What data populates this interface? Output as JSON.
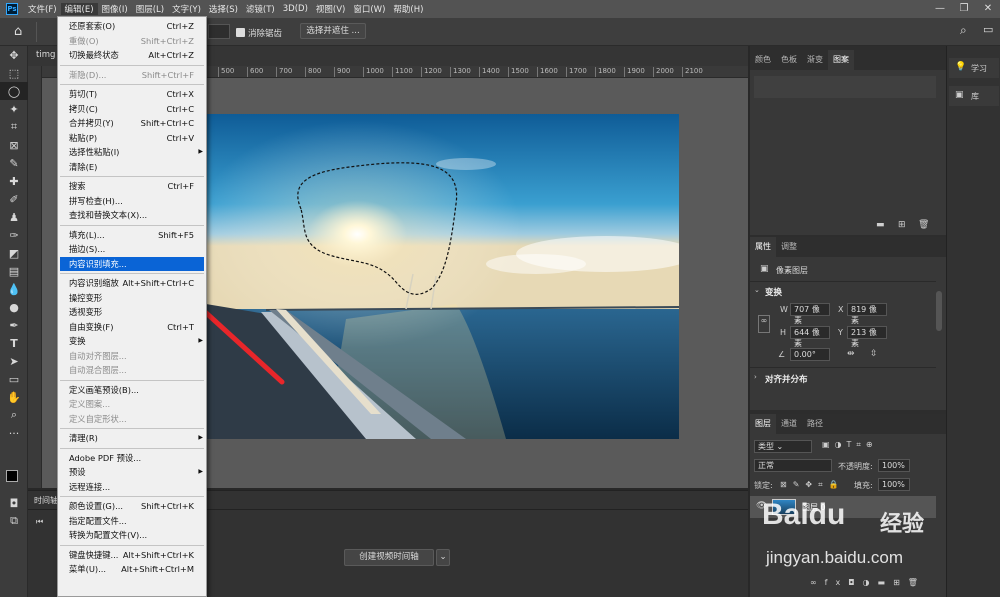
{
  "menubar": {
    "logo": "Ps",
    "items": [
      "文件(F)",
      "编辑(E)",
      "图像(I)",
      "图层(L)",
      "文字(Y)",
      "选择(S)",
      "滤镜(T)",
      "3D(D)",
      "视图(V)",
      "窗口(W)",
      "帮助(H)"
    ],
    "active_index": 1
  },
  "optionsbar": {
    "antialias_label": "消除锯齿",
    "select_mask_label": "选择并遮住 ..."
  },
  "document": {
    "tab_label": "timg",
    "ruler_ticks": [
      "500",
      "600",
      "700",
      "800",
      "900",
      "1000",
      "1100",
      "1200",
      "1300",
      "1400",
      "1500",
      "1600",
      "1700",
      "1800",
      "1900",
      "2000",
      "2100"
    ]
  },
  "timeline": {
    "tab_label": "时间轴",
    "create_button": "创建视频时间轴"
  },
  "color_panel": {
    "tabs": [
      "颜色",
      "色板",
      "渐变",
      "图案"
    ],
    "active": 3
  },
  "properties_panel": {
    "tabs": [
      "属性",
      "调整"
    ],
    "layer_type": "像素图层",
    "transform_title": "变换",
    "w_label": "W",
    "w_value": "707 像素",
    "h_label": "H",
    "h_value": "644 像素",
    "x_label": "X",
    "x_value": "819 像素",
    "y_label": "Y",
    "y_value": "213 像素",
    "angle_value": "0.00°",
    "align_title": "对齐并分布"
  },
  "layers_panel": {
    "tabs": [
      "图层",
      "通道",
      "路径"
    ],
    "filter_kind": "类型",
    "blend_mode": "正常",
    "opacity_label": "不透明度:",
    "opacity_value": "100%",
    "lock_label": "锁定:",
    "fill_label": "填充:",
    "fill_value": "100%",
    "layer_name": "图层 0"
  },
  "far_right": {
    "learn_label": "学习",
    "library_label": "库"
  },
  "edit_menu": {
    "items": [
      {
        "label": "还原套索(O)",
        "shortcut": "Ctrl+Z",
        "disabled": false
      },
      {
        "label": "重做(O)",
        "shortcut": "Shift+Ctrl+Z",
        "disabled": true
      },
      {
        "label": "切换最终状态",
        "shortcut": "Alt+Ctrl+Z",
        "disabled": false
      },
      {
        "sep": true
      },
      {
        "label": "渐隐(D)...",
        "shortcut": "Shift+Ctrl+F",
        "disabled": true
      },
      {
        "sep": true
      },
      {
        "label": "剪切(T)",
        "shortcut": "Ctrl+X",
        "disabled": false
      },
      {
        "label": "拷贝(C)",
        "shortcut": "Ctrl+C",
        "disabled": false
      },
      {
        "label": "合并拷贝(Y)",
        "shortcut": "Shift+Ctrl+C",
        "disabled": false
      },
      {
        "label": "粘贴(P)",
        "shortcut": "Ctrl+V",
        "disabled": false
      },
      {
        "label": "选择性粘贴(I)",
        "shortcut": "",
        "disabled": false,
        "submenu": true
      },
      {
        "label": "清除(E)",
        "shortcut": "",
        "disabled": false
      },
      {
        "sep": true
      },
      {
        "label": "搜索",
        "shortcut": "Ctrl+F",
        "disabled": false
      },
      {
        "label": "拼写检查(H)...",
        "shortcut": "",
        "disabled": false
      },
      {
        "label": "查找和替换文本(X)...",
        "shortcut": "",
        "disabled": false
      },
      {
        "sep": true
      },
      {
        "label": "填充(L)...",
        "shortcut": "Shift+F5",
        "disabled": false
      },
      {
        "label": "描边(S)...",
        "shortcut": "",
        "disabled": false
      },
      {
        "label": "内容识别填充...",
        "shortcut": "",
        "disabled": false,
        "highlighted": true
      },
      {
        "sep": true
      },
      {
        "label": "内容识别缩放",
        "shortcut": "Alt+Shift+Ctrl+C",
        "disabled": false
      },
      {
        "label": "操控变形",
        "shortcut": "",
        "disabled": false
      },
      {
        "label": "透视变形",
        "shortcut": "",
        "disabled": false
      },
      {
        "label": "自由变换(F)",
        "shortcut": "Ctrl+T",
        "disabled": false
      },
      {
        "label": "变换",
        "shortcut": "",
        "disabled": false,
        "submenu": true
      },
      {
        "label": "自动对齐图层...",
        "shortcut": "",
        "disabled": true
      },
      {
        "label": "自动混合图层...",
        "shortcut": "",
        "disabled": true
      },
      {
        "sep": true
      },
      {
        "label": "定义画笔预设(B)...",
        "shortcut": "",
        "disabled": false
      },
      {
        "label": "定义图案...",
        "shortcut": "",
        "disabled": true
      },
      {
        "label": "定义自定形状...",
        "shortcut": "",
        "disabled": true
      },
      {
        "sep": true
      },
      {
        "label": "清理(R)",
        "shortcut": "",
        "disabled": false,
        "submenu": true
      },
      {
        "sep": true
      },
      {
        "label": "Adobe PDF 预设...",
        "shortcut": "",
        "disabled": false
      },
      {
        "label": "预设",
        "shortcut": "",
        "disabled": false,
        "submenu": true
      },
      {
        "label": "远程连接...",
        "shortcut": "",
        "disabled": false
      },
      {
        "sep": true
      },
      {
        "label": "颜色设置(G)...",
        "shortcut": "Shift+Ctrl+K",
        "disabled": false
      },
      {
        "label": "指定配置文件...",
        "shortcut": "",
        "disabled": false
      },
      {
        "label": "转换为配置文件(V)...",
        "shortcut": "",
        "disabled": false
      },
      {
        "sep": true
      },
      {
        "label": "键盘快捷键...",
        "shortcut": "Alt+Shift+Ctrl+K",
        "disabled": false
      },
      {
        "label": "菜单(U)...",
        "shortcut": "Alt+Shift+Ctrl+M",
        "disabled": false
      }
    ]
  },
  "watermark": {
    "brand": "Baidu",
    "brand_cn": "经验",
    "url": "jingyan.baidu.com"
  },
  "colors": {
    "accent": "#0a64d6",
    "arrow": "#e8262a"
  }
}
